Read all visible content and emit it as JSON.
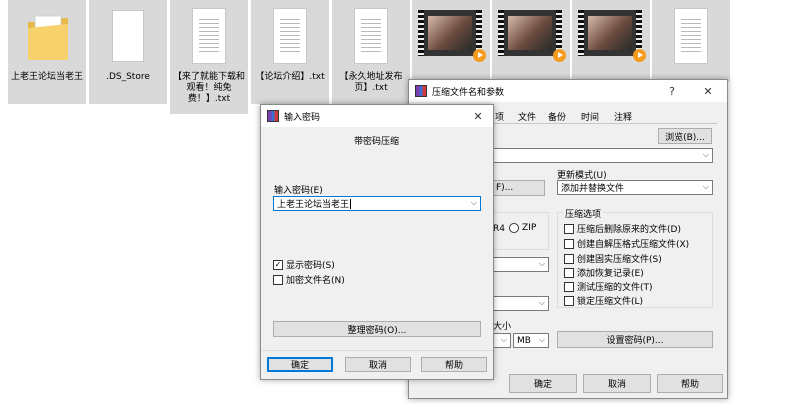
{
  "files": [
    {
      "label": "上老王论坛当老王",
      "icon": "folder-icon"
    },
    {
      "label": ".DS_Store",
      "icon": "blank-file-icon"
    },
    {
      "label": "【来了就能下载和观看！纯免费！】.txt",
      "icon": "text-file-icon"
    },
    {
      "label": "【论坛介绍】.txt",
      "icon": "text-file-icon"
    },
    {
      "label": "【永久地址发布页】.txt",
      "icon": "text-file-icon"
    },
    {
      "label": "",
      "icon": "video-file-icon"
    },
    {
      "label": "",
      "icon": "video-file-icon"
    },
    {
      "label": "",
      "icon": "video-file-icon"
    },
    {
      "label": "",
      "icon": "text-file-icon"
    }
  ],
  "archive_dialog": {
    "title": "压缩文件名和参数",
    "help_symbol": "?",
    "close_symbol": "✕",
    "tabs": [
      "项",
      "文件",
      "备份",
      "时间",
      "注释"
    ],
    "browse_button": "浏览(B)...",
    "profile_button_fragment": "F)...",
    "update_mode_label": "更新模式(U)",
    "update_mode_value": "添加并替换文件",
    "format_fragment": "R4",
    "zip_option": "ZIP",
    "options_group_title": "压缩选项",
    "options": [
      "压缩后删除原来的文件(D)",
      "创建自解压格式压缩文件(X)",
      "创建固实压缩文件(S)",
      "添加恢复记录(E)",
      "测试压缩的文件(T)",
      "锁定压缩文件(L)"
    ],
    "split_size_fragment": "大小",
    "unit_value": "MB",
    "set_password_button": "设置密码(P)...",
    "ok_button": "确定",
    "cancel_button": "取消",
    "help_button": "帮助"
  },
  "password_dialog": {
    "title": "输入密码",
    "close_symbol": "✕",
    "heading": "带密码压缩",
    "enter_password_label": "输入密码(E)",
    "password_value": "上老王论坛当老王",
    "show_password_label": "显示密码(S)",
    "show_password_checked": true,
    "encrypt_names_label": "加密文件名(N)",
    "encrypt_names_checked": false,
    "organize_button": "整理密码(O)...",
    "ok_button": "确定",
    "cancel_button": "取消",
    "help_button": "帮助"
  }
}
